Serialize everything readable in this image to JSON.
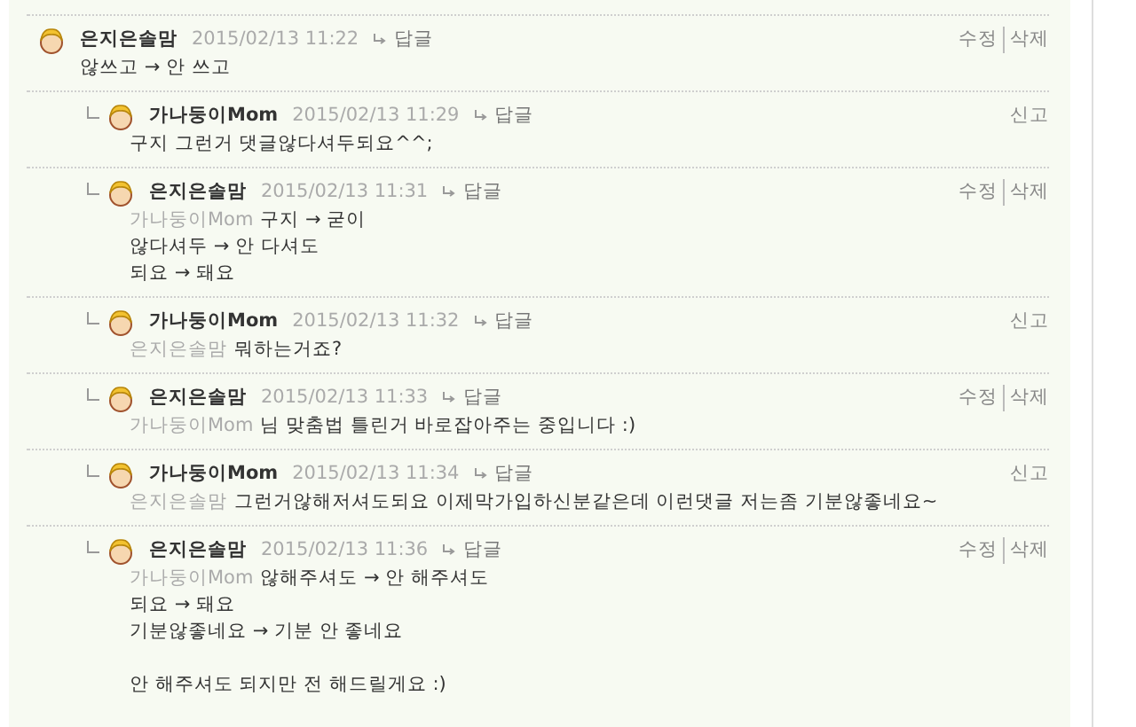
{
  "comments": [
    {
      "kind": "comment",
      "author": "은지은솔맘",
      "date": "2015/02/13 11:22",
      "reply": "답글",
      "actions": [
        "수정",
        "삭제"
      ],
      "paragraphs": [
        [
          "않쓰고 → 안 쓰고"
        ]
      ]
    },
    {
      "kind": "reply",
      "author": "가나둥이Mom",
      "date": "2015/02/13 11:29",
      "reply": "답글",
      "actions": [
        "신고"
      ],
      "paragraphs": [
        [
          "구지 그런거 댓글않다셔두되요^^;"
        ]
      ]
    },
    {
      "kind": "reply",
      "author": "은지은솔맘",
      "date": "2015/02/13 11:31",
      "reply": "답글",
      "actions": [
        "수정",
        "삭제"
      ],
      "mention": "가나둥이Mom",
      "paragraphs": [
        [
          "구지 → 굳이",
          "않다셔두 → 안 다셔도",
          "되요 → 돼요"
        ]
      ]
    },
    {
      "kind": "reply",
      "author": "가나둥이Mom",
      "date": "2015/02/13 11:32",
      "reply": "답글",
      "actions": [
        "신고"
      ],
      "mention": "은지은솔맘",
      "paragraphs": [
        [
          "뭐하는거죠?"
        ]
      ]
    },
    {
      "kind": "reply",
      "author": "은지은솔맘",
      "date": "2015/02/13 11:33",
      "reply": "답글",
      "actions": [
        "수정",
        "삭제"
      ],
      "mention": "가나둥이Mom",
      "paragraphs": [
        [
          "님 맞춤법 틀린거 바로잡아주는 중입니다 :)"
        ]
      ]
    },
    {
      "kind": "reply",
      "author": "가나둥이Mom",
      "date": "2015/02/13 11:34",
      "reply": "답글",
      "actions": [
        "신고"
      ],
      "mention": "은지은솔맘",
      "paragraphs": [
        [
          "그런거않해저셔도되요 이제막가입하신분같은데 이런댓글 저는좀 기분않좋네요~"
        ]
      ]
    },
    {
      "kind": "reply",
      "author": "은지은솔맘",
      "date": "2015/02/13 11:36",
      "reply": "답글",
      "actions": [
        "수정",
        "삭제"
      ],
      "mention": "가나둥이Mom",
      "paragraphs": [
        [
          "않해주셔도 → 안 해주셔도",
          "되요 → 돼요",
          "기분않좋네요 → 기분 안 좋네요"
        ],
        [
          "안 해주셔도 되지만 전 해드릴게요 :)"
        ]
      ]
    }
  ]
}
